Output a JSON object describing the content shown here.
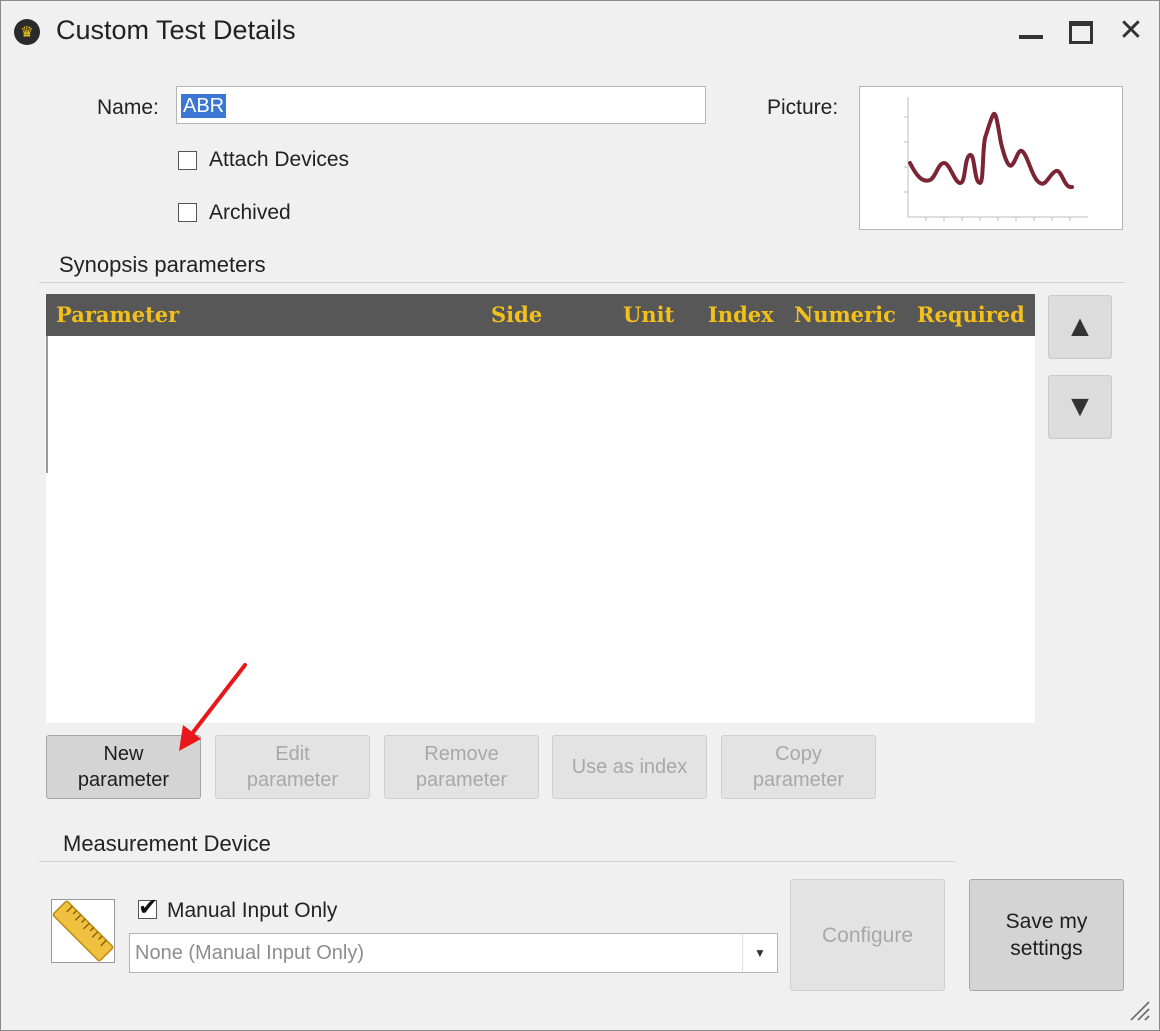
{
  "window": {
    "title": "Custom Test Details"
  },
  "form": {
    "name_label": "Name:",
    "name_value": "ABR",
    "picture_label": "Picture:",
    "attach_devices_label": "Attach Devices",
    "attach_devices_checked": false,
    "archived_label": "Archived",
    "archived_checked": false
  },
  "synopsis": {
    "section_title": "Synopsis parameters",
    "columns": [
      "Parameter",
      "Side",
      "Unit",
      "Index",
      "Numeric",
      "Required"
    ],
    "rows": [],
    "move_up_icon": "up-triangle-icon",
    "move_down_icon": "down-triangle-icon"
  },
  "actions": {
    "new_parameter": "New\nparameter",
    "edit_parameter": "Edit\nparameter",
    "remove_parameter": "Remove\nparameter",
    "use_as_index": "Use as index",
    "copy_parameter": "Copy\nparameter"
  },
  "measurement": {
    "section_title": "Measurement Device",
    "manual_input_label": "Manual Input Only",
    "manual_input_checked": true,
    "device_value": "None (Manual Input Only)",
    "configure_label": "Configure",
    "save_label": "Save my\nsettings",
    "device_icon": "ruler-icon"
  },
  "colors": {
    "header_bg": "#575757",
    "header_text": "#f2c019",
    "annotation_arrow": "#e8181a",
    "plot_line": "#7a2434",
    "selection": "#3b78d6"
  }
}
